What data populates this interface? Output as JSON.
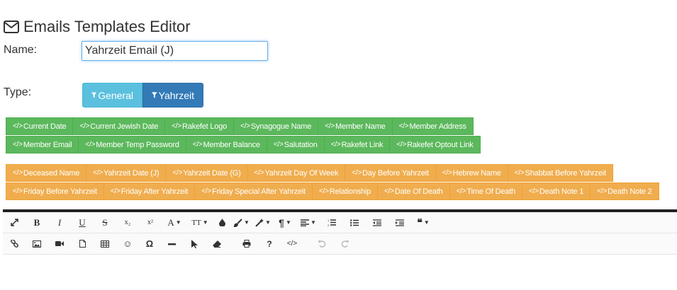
{
  "header": {
    "title": "Emails Templates Editor",
    "icon": "envelope-icon"
  },
  "name_field": {
    "label": "Name:",
    "value": "Yahrzeit Email (J)"
  },
  "type_field": {
    "label": "Type:",
    "options": [
      {
        "label": "General",
        "icon": "filter-icon",
        "selected": false,
        "color": "#5bc0de"
      },
      {
        "label": "Yahrzeit",
        "icon": "filter-icon",
        "selected": true,
        "color": "#337ab7"
      }
    ]
  },
  "tags": {
    "general_row1": [
      "Current Date",
      "Current Jewish Date",
      "Rakefet Logo",
      "Synagogue Name",
      "Member Name",
      "Member Address"
    ],
    "general_row2": [
      "Member Email",
      "Member Temp Password",
      "Member Balance",
      "Salutation",
      "Rakefet Link",
      "Rakefet Optout Link"
    ],
    "yahrzeit_row1": [
      "Deceased Name",
      "Yahrzeit Date (J)",
      "Yahrzeit Date (G)",
      "Yahrzeit Day Of Week",
      "Day Before Yahrzeit",
      "Hebrew Name",
      "Shabbat Before Yahrzeit"
    ],
    "yahrzeit_row2": [
      "Friday Before Yahrzeit",
      "Friday After Yahrzeit",
      "Friday Special After Yahrzeit",
      "Relationship",
      "Date Of Death",
      "Time Of Death",
      "Death Note 1",
      "Death Note 2"
    ],
    "code_glyph": "</>",
    "green": "#5cb85c",
    "orange": "#f0ad4e"
  },
  "toolbar": {
    "bold": "B",
    "italic": "I",
    "underline": "U",
    "strike": "S",
    "subscript": "x₂",
    "superscript": "x²",
    "font_name": "A",
    "font_size": "TT",
    "help": "?",
    "code_view": "</>"
  }
}
